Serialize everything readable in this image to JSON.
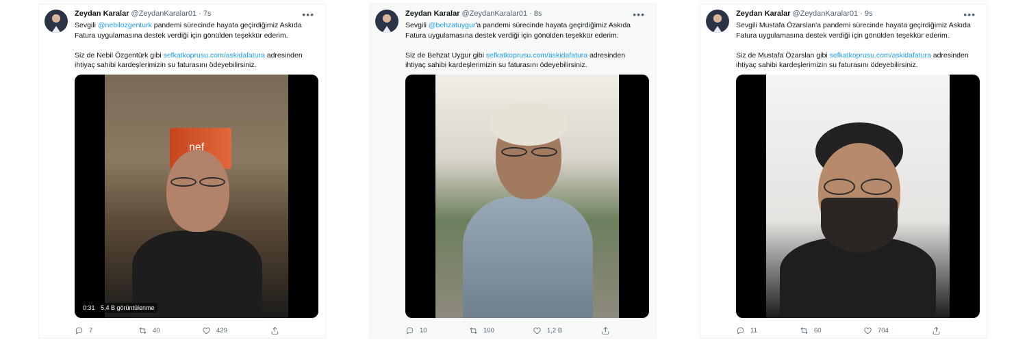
{
  "tweets": [
    {
      "display_name": "Zeydan Karalar",
      "handle": "@ZeydanKaralar01",
      "separator": "·",
      "time": "7s",
      "line1_pre": "Sevgili ",
      "mention": "@nebilozgenturk",
      "line1_post": " pandemi sürecinde hayata geçirdiğimiz Askıda Fatura uygulamasına destek verdiği için gönülden teşekkür ederim.",
      "line2_pre": "Siz de Nebil Özgentürk gibi ",
      "link": "sefkatkoprusu.com/askidafatura",
      "line2_post": " adresinden ihtiyaç sahibi kardeşlerimizin su faturasını ödeyebilirsiniz.",
      "video_time": "0:31",
      "video_views": "5,4 B görüntülenme",
      "replies": "7",
      "retweets": "40",
      "likes": "429"
    },
    {
      "display_name": "Zeydan Karalar",
      "handle": "@ZeydanKaralar01",
      "separator": "·",
      "time": "8s",
      "line1_pre": "Sevgili ",
      "mention": "@behzatuygur",
      "line1_post": "'a pandemi sürecinde hayata geçirdiğimiz Askıda Fatura uygulamasına destek verdiği için gönülden teşekkür ederim.",
      "line2_pre": "Siz de Behzat Uygur gibi ",
      "link": "sefkatkoprusu.com/askidafatura",
      "line2_post": " adresinden ihtiyaç sahibi kardeşlerimizin su faturasını ödeyebilirsiniz.",
      "replies": "10",
      "retweets": "100",
      "likes": "1,2 B"
    },
    {
      "display_name": "Zeydan Karalar",
      "handle": "@ZeydanKaralar01",
      "separator": "·",
      "time": "9s",
      "line1_pre": "Sevgili Mustafa Özarslan'a pandemi sürecinde hayata geçirdiğimiz Askıda Fatura uygulamasına destek verdiği için gönülden teşekkür ederim.",
      "mention": "",
      "line1_post": "",
      "line2_pre": "Siz de Mustafa Özarslan gibi ",
      "link": "sefkatkoprusu.com/askidafatura",
      "line2_post": " adresinden ihtiyaç sahibi kardeşlerimizin su faturasını ödeyebilirsiniz.",
      "replies": "11",
      "retweets": "60",
      "likes": "704"
    }
  ],
  "icons": {
    "more": "more-horizontal-icon",
    "reply": "reply-icon",
    "retweet": "retweet-icon",
    "like": "heart-icon",
    "share": "share-icon"
  },
  "colors": {
    "link": "#1d9bf0",
    "secondary_text": "#536471",
    "primary_text": "#0f1419"
  }
}
